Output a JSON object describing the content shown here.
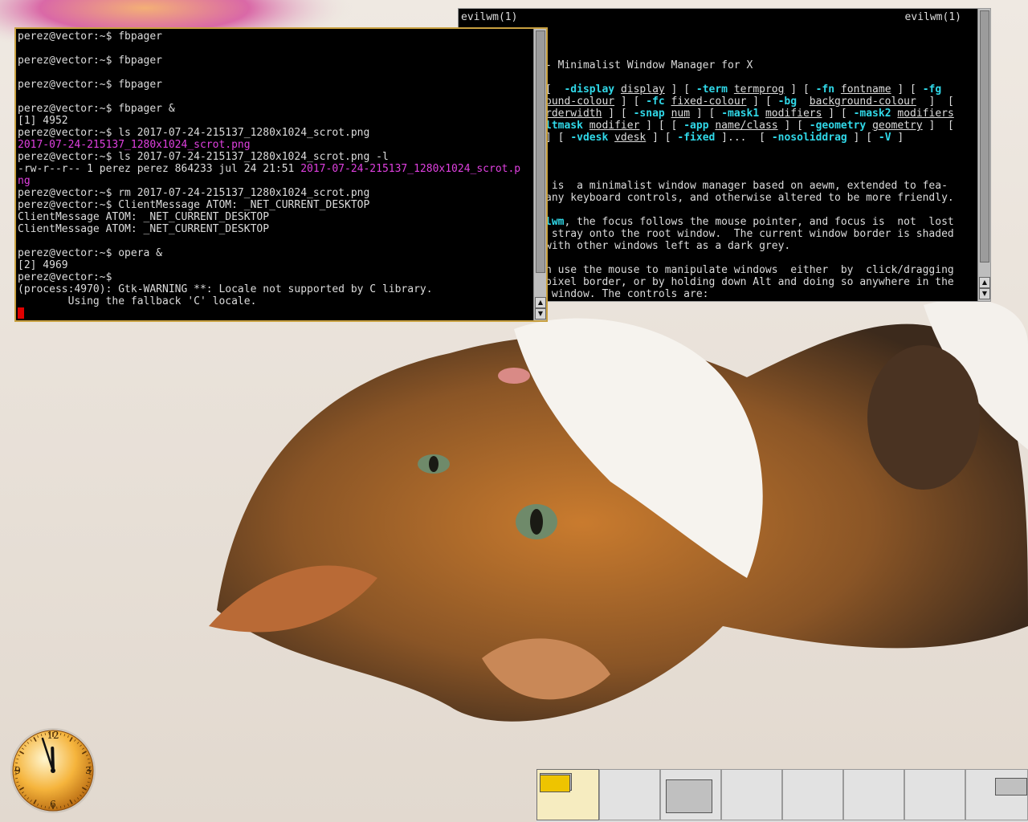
{
  "colors": {
    "terminal_bg": "#000000",
    "terminal_fg": "#dcdcdc",
    "magenta_file": "#e040e0",
    "man_cyan": "#30d8e8",
    "cursor": "#e00000",
    "active_border": "#c8a040",
    "pager_active": "#f6ecc0"
  },
  "man_window": {
    "title_left": "evilwm(1)",
    "title_right": "evilwm(1)",
    "lines": [
      {
        "segments": []
      },
      {
        "segments": [
          {
            "t": "- Minimalist Window Manager for X",
            "c": ""
          }
        ]
      },
      {
        "segments": []
      },
      {
        "segments": [
          {
            "t": "[  ",
            "c": ""
          },
          {
            "t": "-display",
            "c": "cy"
          },
          {
            "t": " ",
            "c": ""
          },
          {
            "t": "display",
            "c": "ul"
          },
          {
            "t": " ] [ ",
            "c": ""
          },
          {
            "t": "-term",
            "c": "cy"
          },
          {
            "t": " ",
            "c": ""
          },
          {
            "t": "termprog",
            "c": "ul"
          },
          {
            "t": " ] [ ",
            "c": ""
          },
          {
            "t": "-fn",
            "c": "cy"
          },
          {
            "t": " ",
            "c": ""
          },
          {
            "t": "fontname",
            "c": "ul"
          },
          {
            "t": " ] [ ",
            "c": ""
          },
          {
            "t": "-fg",
            "c": "cy"
          }
        ]
      },
      {
        "segments": [
          {
            "t": "ound-colour",
            "c": "ul"
          },
          {
            "t": " ] [ ",
            "c": ""
          },
          {
            "t": "-fc",
            "c": "cy"
          },
          {
            "t": " ",
            "c": ""
          },
          {
            "t": "fixed-colour",
            "c": "ul"
          },
          {
            "t": " ] [ ",
            "c": ""
          },
          {
            "t": "-bg",
            "c": "cy"
          },
          {
            "t": "  ",
            "c": ""
          },
          {
            "t": "background-colour",
            "c": "ul"
          },
          {
            "t": "  ]  [",
            "c": ""
          }
        ]
      },
      {
        "segments": [
          {
            "t": "rderwidth",
            "c": "ul"
          },
          {
            "t": " ] [ ",
            "c": ""
          },
          {
            "t": "-snap",
            "c": "cy"
          },
          {
            "t": " ",
            "c": ""
          },
          {
            "t": "num",
            "c": "ul"
          },
          {
            "t": " ] [ ",
            "c": ""
          },
          {
            "t": "-mask1",
            "c": "cy"
          },
          {
            "t": " ",
            "c": ""
          },
          {
            "t": "modifiers",
            "c": "ul"
          },
          {
            "t": " ] [ ",
            "c": ""
          },
          {
            "t": "-mask2",
            "c": "cy"
          },
          {
            "t": " ",
            "c": ""
          },
          {
            "t": "modifiers",
            "c": "ul"
          }
        ]
      },
      {
        "segments": [
          {
            "t": "ltmask",
            "c": "cy"
          },
          {
            "t": " ",
            "c": ""
          },
          {
            "t": "modifier",
            "c": "ul"
          },
          {
            "t": " ] [ [ ",
            "c": ""
          },
          {
            "t": "-app",
            "c": "cy"
          },
          {
            "t": " ",
            "c": ""
          },
          {
            "t": "name/class",
            "c": "ul"
          },
          {
            "t": " ] [ ",
            "c": ""
          },
          {
            "t": "-geometry",
            "c": "cy"
          },
          {
            "t": " ",
            "c": ""
          },
          {
            "t": "geometry",
            "c": "ul"
          },
          {
            "t": " ]  [",
            "c": ""
          }
        ]
      },
      {
        "segments": [
          {
            "t": "] [ ",
            "c": ""
          },
          {
            "t": "-vdesk",
            "c": "cy"
          },
          {
            "t": " ",
            "c": ""
          },
          {
            "t": "vdesk",
            "c": "ul"
          },
          {
            "t": " ] [ ",
            "c": ""
          },
          {
            "t": "-fixed",
            "c": "cy"
          },
          {
            "t": " ]...  [ ",
            "c": ""
          },
          {
            "t": "-nosoliddrag",
            "c": "cy"
          },
          {
            "t": " ] [ ",
            "c": ""
          },
          {
            "t": "-V",
            "c": "cy"
          },
          {
            "t": " ]",
            "c": ""
          }
        ]
      },
      {
        "segments": []
      },
      {
        "segments": []
      },
      {
        "segments": []
      },
      {
        "segments": [
          {
            "t": " is  a minimalist window manager based on aewm, extended to fea-",
            "c": ""
          }
        ]
      },
      {
        "segments": [
          {
            "t": "any keyboard controls, and otherwise altered to be more friendly.",
            "c": ""
          }
        ]
      },
      {
        "segments": []
      },
      {
        "segments": [
          {
            "t": "lwm",
            "c": "cy"
          },
          {
            "t": ", the focus follows the mouse pointer, and focus is  not  lost",
            "c": ""
          }
        ]
      },
      {
        "segments": [
          {
            "t": " stray onto the root window.  The current window border is shaded",
            "c": ""
          }
        ]
      },
      {
        "segments": [
          {
            "t": "with other windows left as a dark grey.",
            "c": ""
          }
        ]
      },
      {
        "segments": []
      },
      {
        "segments": [
          {
            "t": "n use the mouse to manipulate windows  either  by  click/dragging",
            "c": ""
          }
        ]
      },
      {
        "segments": [
          {
            "t": "pixel border, or by holding down Alt and doing so anywhere in the",
            "c": ""
          }
        ]
      },
      {
        "segments": [
          {
            "t": " window. The controls are:",
            "c": ""
          }
        ]
      }
    ]
  },
  "term_window": {
    "lines": [
      {
        "segments": [
          {
            "t": "perez@vector:~$ fbpager",
            "c": ""
          }
        ]
      },
      {
        "segments": []
      },
      {
        "segments": [
          {
            "t": "perez@vector:~$ fbpager",
            "c": ""
          }
        ]
      },
      {
        "segments": []
      },
      {
        "segments": [
          {
            "t": "perez@vector:~$ fbpager",
            "c": ""
          }
        ]
      },
      {
        "segments": []
      },
      {
        "segments": [
          {
            "t": "perez@vector:~$ fbpager &",
            "c": ""
          }
        ]
      },
      {
        "segments": [
          {
            "t": "[1] 4952",
            "c": ""
          }
        ]
      },
      {
        "segments": [
          {
            "t": "perez@vector:~$ ls 2017-07-24-215137_1280x1024_scrot.png",
            "c": ""
          }
        ]
      },
      {
        "segments": [
          {
            "t": "2017-07-24-215137_1280x1024_scrot.png",
            "c": "mag"
          }
        ]
      },
      {
        "segments": [
          {
            "t": "perez@vector:~$ ls 2017-07-24-215137_1280x1024_scrot.png -l",
            "c": ""
          }
        ]
      },
      {
        "segments": [
          {
            "t": "-rw-r--r-- 1 perez perez 864233 jul 24 21:51 ",
            "c": ""
          },
          {
            "t": "2017-07-24-215137_1280x1024_scrot.p",
            "c": "mag"
          }
        ]
      },
      {
        "segments": [
          {
            "t": "ng",
            "c": "mag"
          }
        ]
      },
      {
        "segments": [
          {
            "t": "perez@vector:~$ rm 2017-07-24-215137_1280x1024_scrot.png",
            "c": ""
          }
        ]
      },
      {
        "segments": [
          {
            "t": "perez@vector:~$ ClientMessage ATOM: _NET_CURRENT_DESKTOP",
            "c": ""
          }
        ]
      },
      {
        "segments": [
          {
            "t": "ClientMessage ATOM: _NET_CURRENT_DESKTOP",
            "c": ""
          }
        ]
      },
      {
        "segments": [
          {
            "t": "ClientMessage ATOM: _NET_CURRENT_DESKTOP",
            "c": ""
          }
        ]
      },
      {
        "segments": []
      },
      {
        "segments": [
          {
            "t": "perez@vector:~$ opera &",
            "c": ""
          }
        ]
      },
      {
        "segments": [
          {
            "t": "[2] 4969",
            "c": ""
          }
        ]
      },
      {
        "segments": [
          {
            "t": "perez@vector:~$",
            "c": ""
          }
        ]
      },
      {
        "segments": [
          {
            "t": "(process:4970): Gtk-WARNING **: Locale not supported by C library.",
            "c": ""
          }
        ]
      },
      {
        "segments": [
          {
            "t": "        Using the fallback 'C' locale.",
            "c": ""
          }
        ]
      }
    ]
  },
  "clock": {
    "numerals": [
      "12",
      "3",
      "6",
      "9"
    ],
    "hour": 11,
    "minute": 57
  },
  "pager": {
    "desktops": [
      {
        "active": true
      },
      {
        "active": false
      },
      {
        "active": false
      },
      {
        "active": false
      },
      {
        "active": false
      },
      {
        "active": false
      },
      {
        "active": false
      },
      {
        "active": false
      }
    ]
  }
}
